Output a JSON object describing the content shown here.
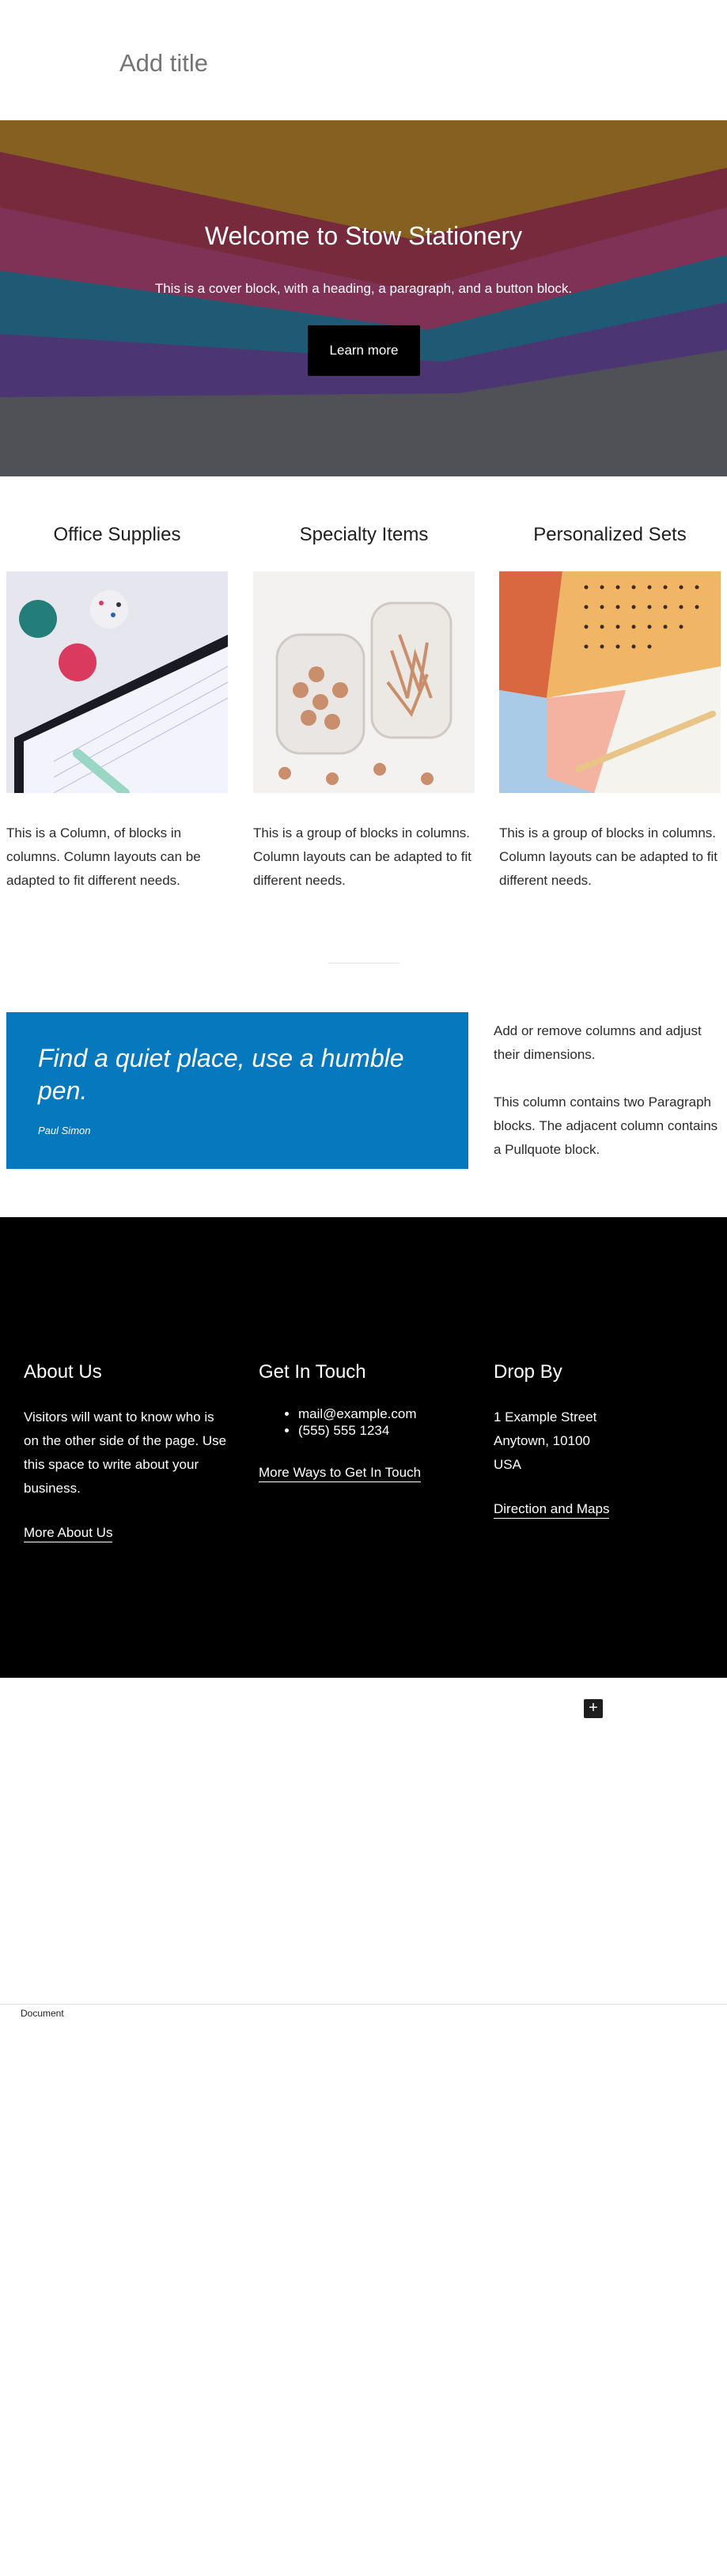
{
  "post": {
    "title_placeholder": "Add title"
  },
  "cover": {
    "heading": "Welcome to Stow Stationery",
    "paragraph": "This is a cover block, with a heading, a paragraph, and a button block.",
    "button_label": "Learn more"
  },
  "columns": [
    {
      "heading": "Office Supplies",
      "text": "This is a Column, of blocks in columns. Column layouts can be adapted to fit different needs.",
      "image_icon": "pins-notebook-image"
    },
    {
      "heading": "Specialty Items",
      "text": "This is a group of blocks in columns. Column layouts can be adapted to fit different needs.",
      "image_icon": "copper-clips-jars-image"
    },
    {
      "heading": "Personalized Sets",
      "text": "This is a group of blocks in columns. Column layouts can be adapted to fit different needs.",
      "image_icon": "notebook-pencil-image"
    }
  ],
  "pullquote": {
    "text": "Find a quiet place, use a humble pen.",
    "citation": "Paul Simon",
    "background": "#0678be"
  },
  "side_column": {
    "paragraph_1": "Add or remove columns and adjust their dimensions.",
    "paragraph_2": "This column contains two Paragraph blocks. The adjacent column contains a Pullquote block."
  },
  "footer": {
    "about": {
      "heading": "About Us",
      "text": "Visitors will want to know who is on the other side of the page. Use this space to write about your business.",
      "link": "More About Us"
    },
    "contact": {
      "heading": "Get In Touch",
      "items": [
        "mail@example.com",
        "(555) 555 1234"
      ],
      "link": "More Ways to Get In Touch"
    },
    "visit": {
      "heading": "Drop By",
      "lines": [
        "1 Example Street",
        "Anytown, 10100",
        "USA"
      ],
      "link": "Direction and Maps"
    }
  },
  "inserter": {
    "icon": "plus-icon",
    "glyph": "+"
  },
  "statusbar": {
    "breadcrumb": "Document"
  }
}
